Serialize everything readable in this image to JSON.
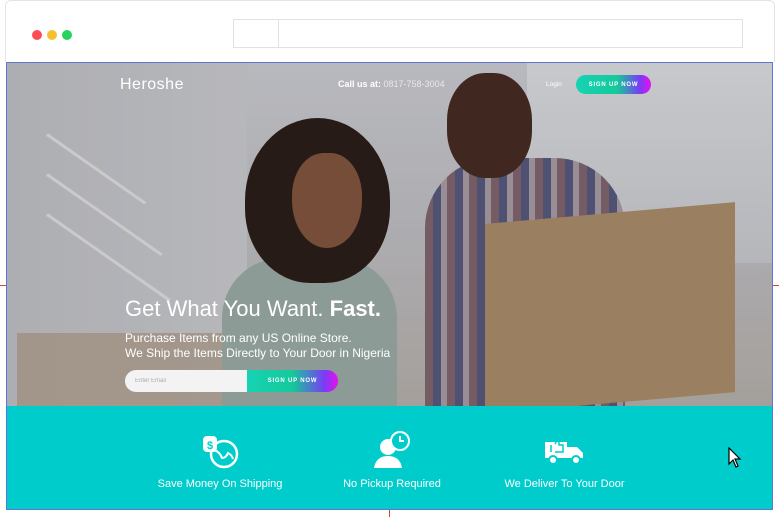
{
  "browser": {
    "traffic_lights": {
      "red": "#fc4d57",
      "yellow": "#f5c12e",
      "green": "#27d35f"
    }
  },
  "header": {
    "logo": "Heroshe",
    "call_label": "Call us at:",
    "phone": "0817-758-3004",
    "login": "Login",
    "signup": "SIGN UP NOW"
  },
  "hero": {
    "headline_regular": "Get What You Want.",
    "headline_bold": "Fast.",
    "sub_line1": "Purchase Items from any US Online Store.",
    "sub_line2": "We Ship the Items Directly to Your Door in Nigeria",
    "email_placeholder": "Enter Email",
    "signup": "SIGN UP NOW"
  },
  "features": [
    {
      "label": "Save Money On Shipping",
      "icon": "money-globe-icon"
    },
    {
      "label": "No Pickup Required",
      "icon": "person-clock-icon"
    },
    {
      "label": "We Deliver To Your Door",
      "icon": "delivery-truck-icon"
    }
  ],
  "colors": {
    "accent_teal": "#00cccc",
    "gradient_start": "#16d3b4",
    "gradient_end": "#e510f0"
  }
}
